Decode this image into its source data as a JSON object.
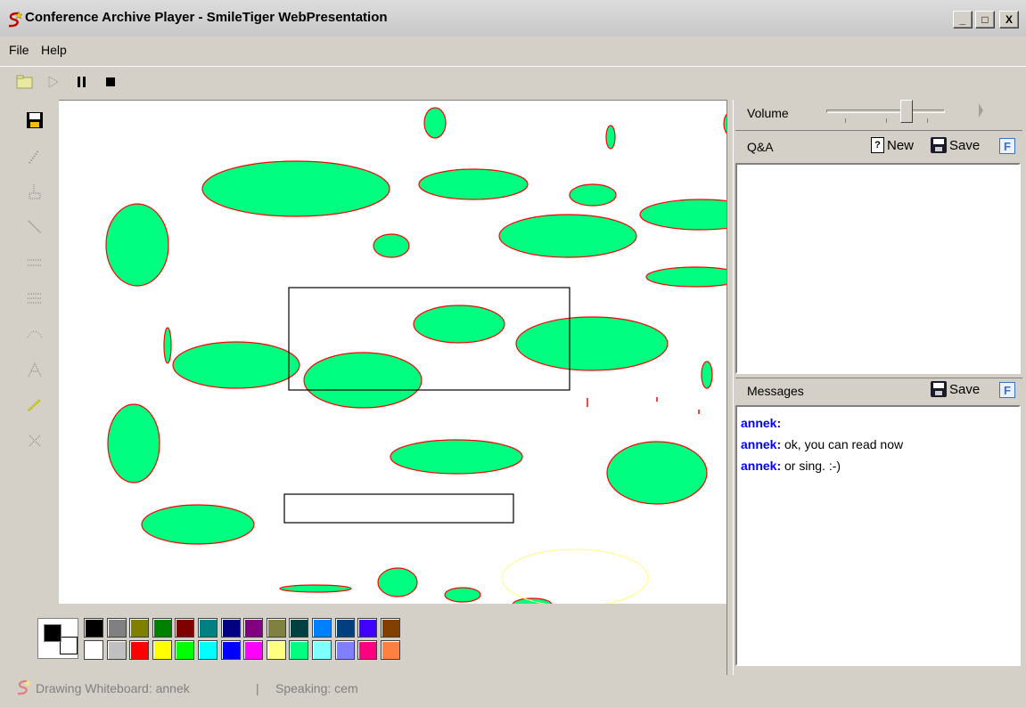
{
  "window": {
    "title": "Conference Archive Player - SmileTiger WebPresentation",
    "minimize_glyph": "_",
    "maximize_glyph": "□",
    "close_glyph": "X"
  },
  "menu": {
    "file": "File",
    "help": "Help"
  },
  "toolbar": {
    "icons": [
      "open-icon",
      "play-icon",
      "pause-icon",
      "stop-icon"
    ]
  },
  "tools": [
    "save-icon",
    "pencil-icon",
    "marker-icon",
    "line-icon",
    "dotted-line-icon",
    "dashed-line-icon",
    "curve-icon",
    "text-icon",
    "highlighter-icon",
    "eraser-icon"
  ],
  "colors": {
    "ellipse_fill": "#00ff80",
    "ellipse_stroke": "#ff0000",
    "foreground": "#000000",
    "background": "#ffffff",
    "palette_row1": [
      "#000000",
      "#808080",
      "#808000",
      "#008000",
      "#800000",
      "#008080",
      "#000080",
      "#800080",
      "#808040",
      "#004040",
      "#0080ff",
      "#004080",
      "#4000ff",
      "#804000"
    ],
    "palette_row2": [
      "#ffffff",
      "#c0c0c0",
      "#ff0000",
      "#ffff00",
      "#00ff00",
      "#00ffff",
      "#0000ff",
      "#ff00ff",
      "#ffff80",
      "#00ff80",
      "#80ffff",
      "#8080ff",
      "#ff0080",
      "#ff8040"
    ]
  },
  "volume": {
    "label": "Volume",
    "level": 0.68
  },
  "qa": {
    "label": "Q&A",
    "new_label": "New",
    "save_label": "Save",
    "f_glyph": "F"
  },
  "messages": {
    "label": "Messages",
    "save_label": "Save",
    "f_glyph": "F",
    "items": [
      {
        "user": "annek:",
        "text": ""
      },
      {
        "user": "annek:",
        "text": "ok, you can read now"
      },
      {
        "user": "annek:",
        "text": "or sing. :-)"
      }
    ]
  },
  "status": {
    "drawing": "Drawing Whiteboard: annek",
    "separator": "|",
    "speaking": "Speaking: cem"
  }
}
